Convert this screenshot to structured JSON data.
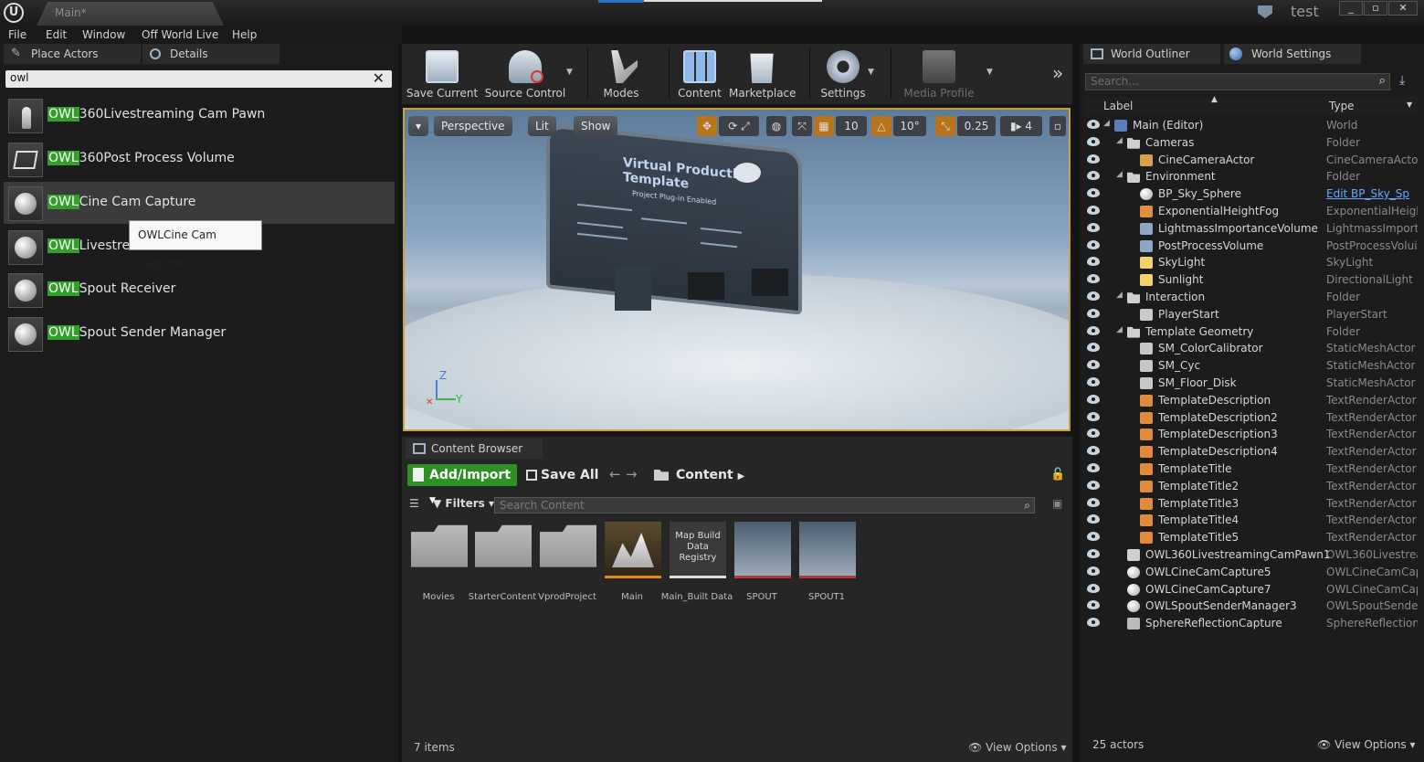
{
  "titlebar": {
    "tab": "Main*",
    "user": "test"
  },
  "menu": [
    "File",
    "Edit",
    "Window",
    "Off World Live",
    "Help"
  ],
  "left_panel": {
    "tabs": [
      "Place Actors",
      "Details"
    ],
    "search_value": "owl",
    "actors": [
      {
        "hl": "OWL",
        "rest": "360Livestreaming Cam Pawn"
      },
      {
        "hl": "OWL",
        "rest": "360Post Process Volume"
      },
      {
        "hl": "OWL",
        "rest": "Cine Cam Capture"
      },
      {
        "hl": "OWL",
        "rest": "Livestrea"
      },
      {
        "hl": "OWL",
        "rest": "Spout Receiver"
      },
      {
        "hl": "OWL",
        "rest": "Spout Sender Manager"
      }
    ],
    "tooltip": "OWLCine Cam Capture"
  },
  "toolbar": {
    "save_current": "Save Current",
    "source_control": "Source Control",
    "modes": "Modes",
    "content": "Content",
    "marketplace": "Marketplace",
    "settings": "Settings",
    "media_profile": "Media Profile",
    "overflow": "»"
  },
  "viewport": {
    "perspective": "Perspective",
    "lit": "Lit",
    "show": "Show",
    "grid_snap": "10",
    "rot_snap": "10°",
    "scale_snap": "0.25",
    "cam_speed": "4",
    "board_title": "Virtual Production Template",
    "board_sub": "Project Plug-in Enabled",
    "axis_z": "Z",
    "axis_y": "Y"
  },
  "content_browser": {
    "tab": "Content Browser",
    "add_import": "Add/Import",
    "save_all": "Save All",
    "path": "Content",
    "filters": "Filters",
    "search_placeholder": "Search Content",
    "assets": [
      {
        "label": "Movies",
        "kind": "folder"
      },
      {
        "label": "StarterContent",
        "kind": "folder"
      },
      {
        "label": "VprodProject",
        "kind": "folder"
      },
      {
        "label": "Main",
        "kind": "level"
      },
      {
        "label": "Main_Built Data",
        "kind": "data",
        "thumb": "Map Build Data Registry"
      },
      {
        "label": "SPOUT",
        "kind": "image"
      },
      {
        "label": "SPOUT1",
        "kind": "image"
      }
    ],
    "item_count": "7 items",
    "view_options": "View Options"
  },
  "outliner": {
    "tabs": [
      "World Outliner",
      "World Settings"
    ],
    "search_placeholder": "Search...",
    "col_label": "Label",
    "col_type": "Type",
    "rows": [
      {
        "label": "Main (Editor)",
        "type": "World",
        "indent": 0,
        "icon": "world"
      },
      {
        "label": "Cameras",
        "type": "Folder",
        "indent": 1,
        "icon": "folder"
      },
      {
        "label": "CineCameraActor",
        "type": "CineCameraActor",
        "indent": 2,
        "icon": "camera"
      },
      {
        "label": "Environment",
        "type": "Folder",
        "indent": 1,
        "icon": "folder"
      },
      {
        "label": "BP_Sky_Sphere",
        "type": "Edit BP_Sky_Sp",
        "indent": 2,
        "icon": "sphere",
        "link": true
      },
      {
        "label": "ExponentialHeightFog",
        "type": "ExponentialHeigh",
        "indent": 2,
        "icon": "fog"
      },
      {
        "label": "LightmassImportanceVolume",
        "type": "LightmassImporta",
        "indent": 2,
        "icon": "volume"
      },
      {
        "label": "PostProcessVolume",
        "type": "PostProcessVolui",
        "indent": 2,
        "icon": "volume"
      },
      {
        "label": "SkyLight",
        "type": "SkyLight",
        "indent": 2,
        "icon": "light"
      },
      {
        "label": "Sunlight",
        "type": "DirectionalLight",
        "indent": 2,
        "icon": "light"
      },
      {
        "label": "Interaction",
        "type": "Folder",
        "indent": 1,
        "icon": "folder"
      },
      {
        "label": "PlayerStart",
        "type": "PlayerStart",
        "indent": 2,
        "icon": "player"
      },
      {
        "label": "Template Geometry",
        "type": "Folder",
        "indent": 1,
        "icon": "folder"
      },
      {
        "label": "SM_ColorCalibrator",
        "type": "StaticMeshActor",
        "indent": 2,
        "icon": "mesh"
      },
      {
        "label": "SM_Cyc",
        "type": "StaticMeshActor",
        "indent": 2,
        "icon": "mesh"
      },
      {
        "label": "SM_Floor_Disk",
        "type": "StaticMeshActor",
        "indent": 2,
        "icon": "mesh"
      },
      {
        "label": "TemplateDescription",
        "type": "TextRenderActor",
        "indent": 2,
        "icon": "text"
      },
      {
        "label": "TemplateDescription2",
        "type": "TextRenderActor",
        "indent": 2,
        "icon": "text"
      },
      {
        "label": "TemplateDescription3",
        "type": "TextRenderActor",
        "indent": 2,
        "icon": "text"
      },
      {
        "label": "TemplateDescription4",
        "type": "TextRenderActor",
        "indent": 2,
        "icon": "text"
      },
      {
        "label": "TemplateTitle",
        "type": "TextRenderActor",
        "indent": 2,
        "icon": "text"
      },
      {
        "label": "TemplateTitle2",
        "type": "TextRenderActor",
        "indent": 2,
        "icon": "text"
      },
      {
        "label": "TemplateTitle3",
        "type": "TextRenderActor",
        "indent": 2,
        "icon": "text"
      },
      {
        "label": "TemplateTitle4",
        "type": "TextRenderActor",
        "indent": 2,
        "icon": "text"
      },
      {
        "label": "TemplateTitle5",
        "type": "TextRenderActor",
        "indent": 2,
        "icon": "text"
      },
      {
        "label": "OWL360LivestreamingCamPawn1",
        "type": "OWL360Livestrear",
        "indent": 1,
        "icon": "pawn"
      },
      {
        "label": "OWLCineCamCapture5",
        "type": "OWLCineCamCapt",
        "indent": 1,
        "icon": "sphere"
      },
      {
        "label": "OWLCineCamCapture7",
        "type": "OWLCineCamCapt",
        "indent": 1,
        "icon": "sphere"
      },
      {
        "label": "OWLSpoutSenderManager3",
        "type": "OWLSpoutSender",
        "indent": 1,
        "icon": "sphere"
      },
      {
        "label": "SphereReflectionCapture",
        "type": "SphereReflection(",
        "indent": 1,
        "icon": "reflect"
      }
    ],
    "actor_count": "25 actors",
    "view_options": "View Options"
  }
}
